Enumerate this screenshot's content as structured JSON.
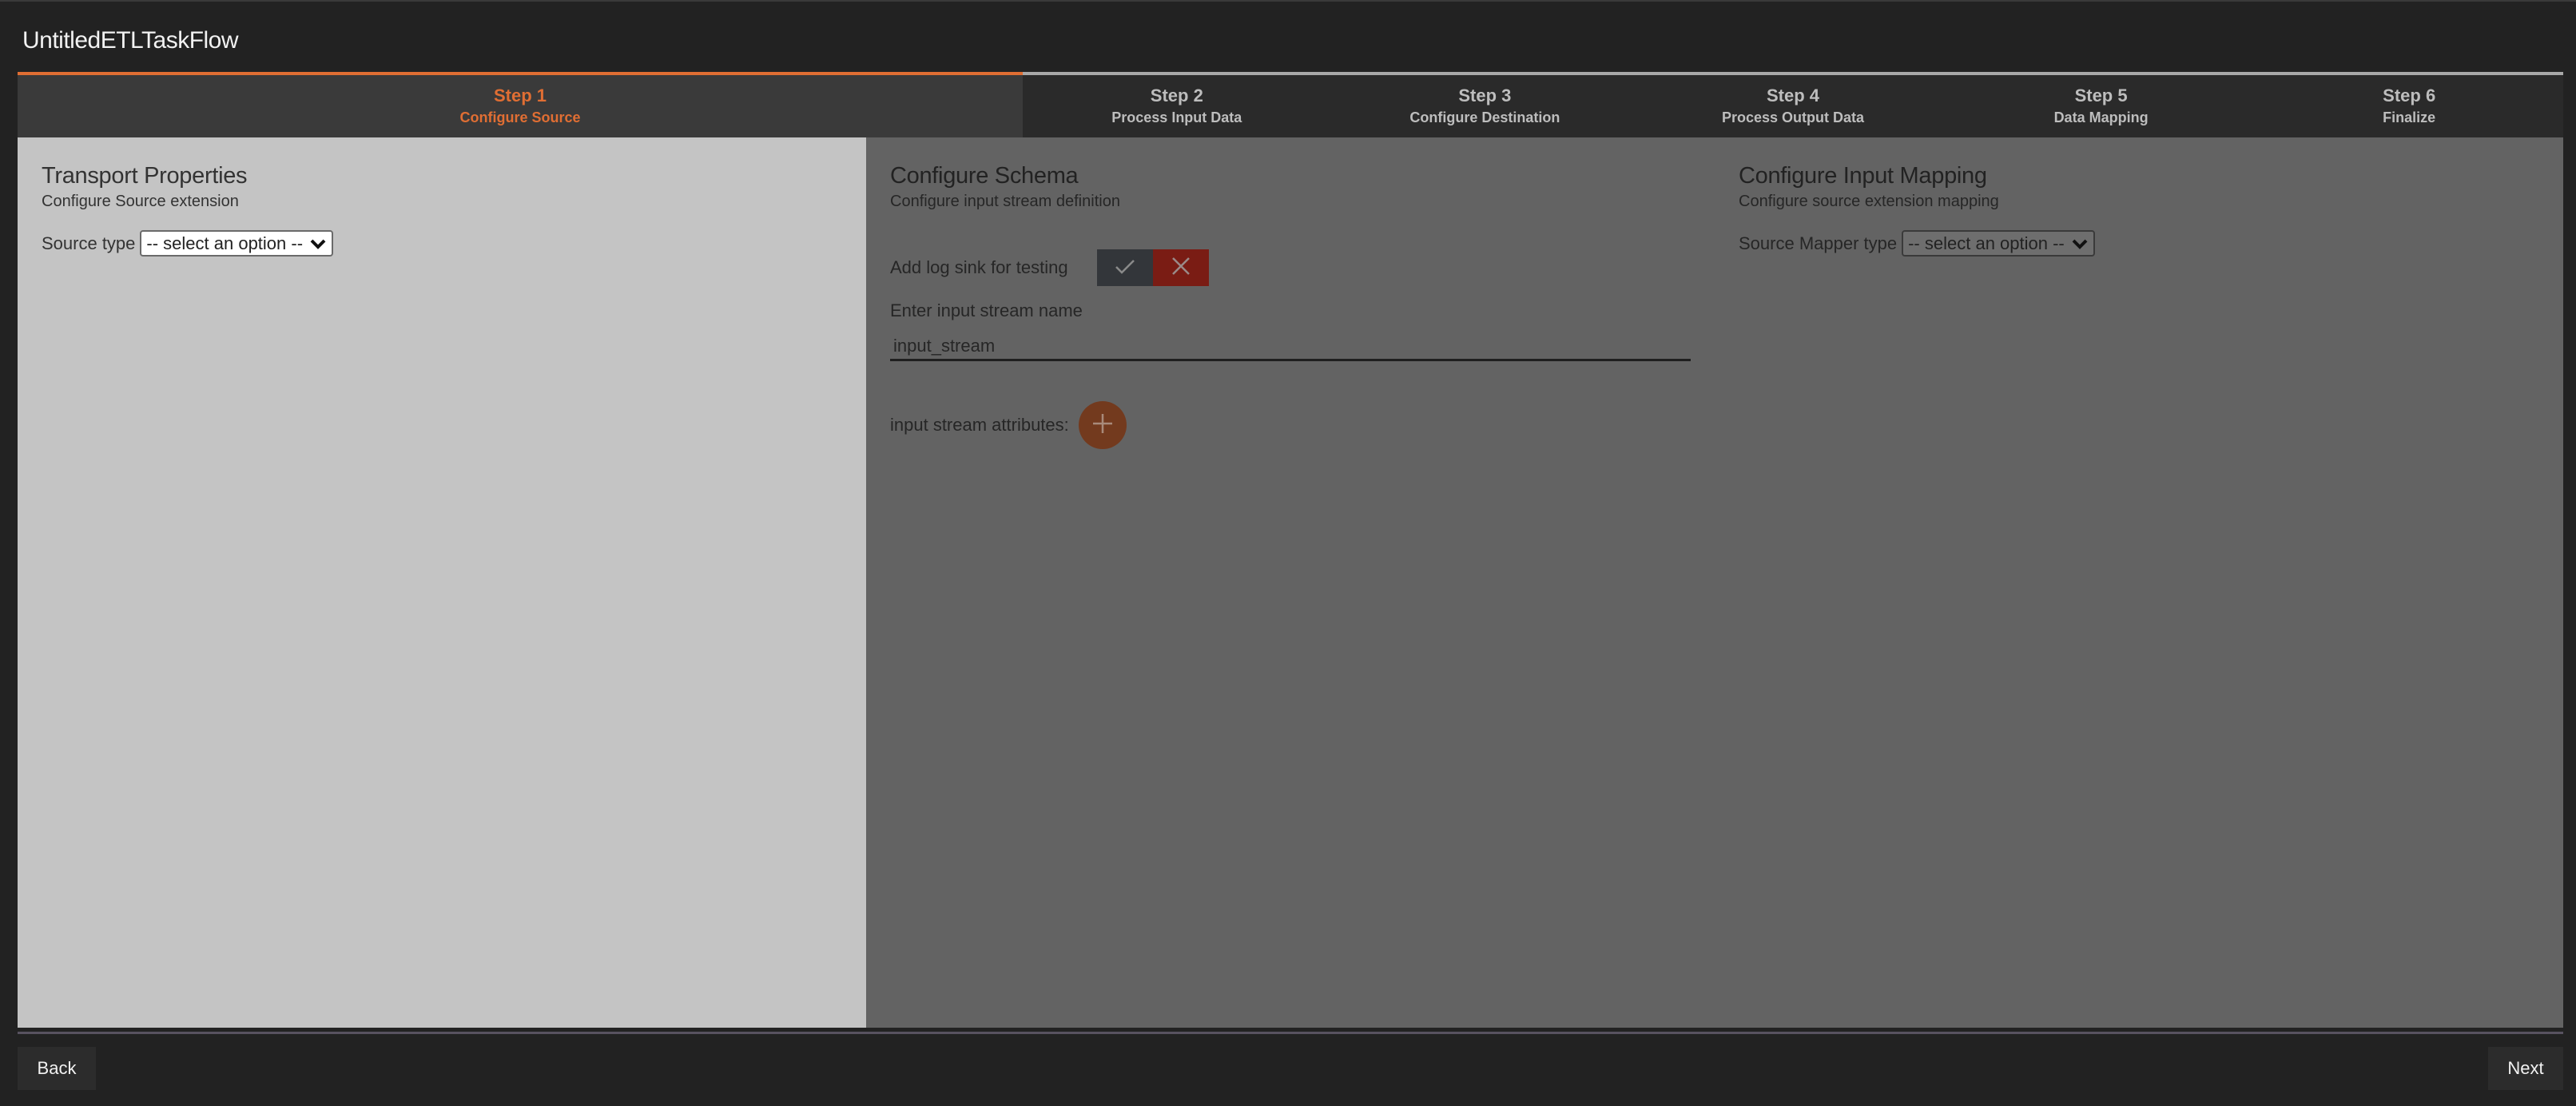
{
  "app": {
    "title": "UntitledETLTaskFlow"
  },
  "progress": {
    "current_step": 1,
    "total_steps": 6,
    "accent_color": "#e06e33"
  },
  "steps": [
    {
      "number": "Step 1",
      "label": "Configure Source",
      "active": true
    },
    {
      "number": "Step 2",
      "label": "Process Input Data",
      "active": false
    },
    {
      "number": "Step 3",
      "label": "Configure Destination",
      "active": false
    },
    {
      "number": "Step 4",
      "label": "Process Output Data",
      "active": false
    },
    {
      "number": "Step 5",
      "label": "Data Mapping",
      "active": false
    },
    {
      "number": "Step 6",
      "label": "Finalize",
      "active": false
    }
  ],
  "transport_panel": {
    "title": "Transport Properties",
    "subtitle": "Configure Source extension",
    "source_type_label": "Source type",
    "source_type_value": "-- select an option --"
  },
  "schema_panel": {
    "title": "Configure Schema",
    "subtitle": "Configure input stream definition",
    "log_sink_label": "Add log sink for testing",
    "log_sink_yes_icon": "check-icon",
    "log_sink_no_icon": "close-icon",
    "log_sink_value": false,
    "stream_name_label": "Enter input stream name",
    "stream_name_value": "input_stream",
    "attributes_label": "input stream attributes:",
    "add_attribute_icon": "plus-icon"
  },
  "mapping_panel": {
    "title": "Configure Input Mapping",
    "subtitle": "Configure source extension mapping",
    "mapper_type_label": "Source Mapper type",
    "mapper_type_value": "-- select an option --"
  },
  "footer": {
    "back_label": "Back",
    "next_label": "Next"
  }
}
